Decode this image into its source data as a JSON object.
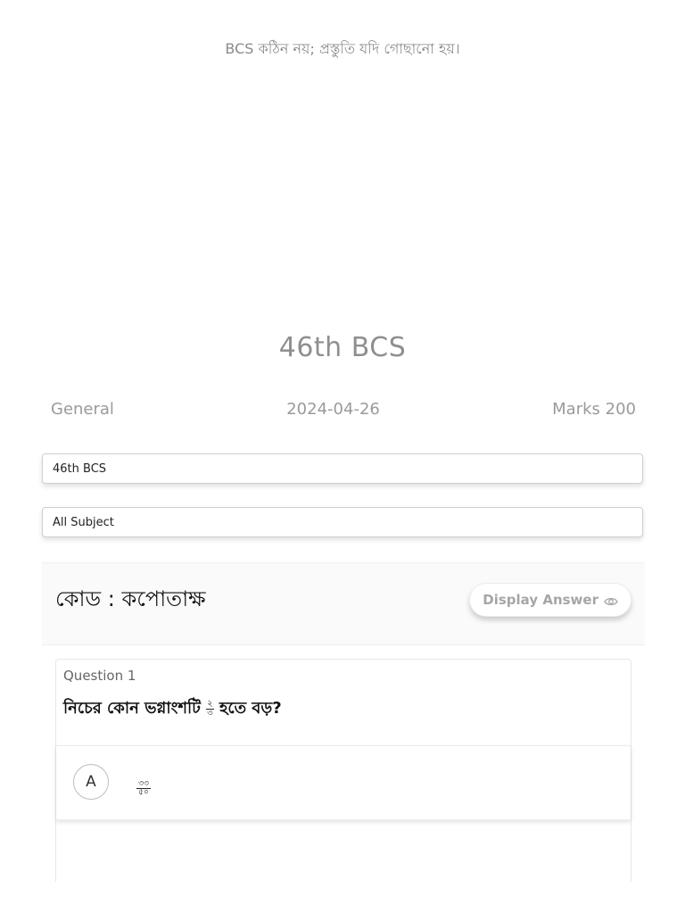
{
  "header": {
    "tagline": "BCS কঠিন নয়; প্রস্তুতি যদি গোছানো হয়।"
  },
  "exam": {
    "title": "46th BCS",
    "category": "General",
    "date": "2024-04-26",
    "marks": "Marks 200"
  },
  "filters": {
    "exam_selected": "46th BCS",
    "subject_selected": "All Subject"
  },
  "code_panel": {
    "code_label": "কোড : কপোতাক্ষ",
    "display_answer_label": "Display Answer",
    "display_answer_icon": "eye-icon"
  },
  "question": {
    "number_label": "Question 1",
    "text_before": "নিচের কোন ভগ্নাংশটি",
    "fraction_numerator": "২",
    "fraction_denominator": "৩",
    "text_after": "হতে বড়?",
    "options": [
      {
        "letter": "A",
        "numerator": "৩৩",
        "denominator": "৫০"
      }
    ]
  },
  "colors": {
    "muted_text": "#8f8f8f",
    "button_text": "#a6a6a6",
    "border": "#cfcfcf"
  }
}
